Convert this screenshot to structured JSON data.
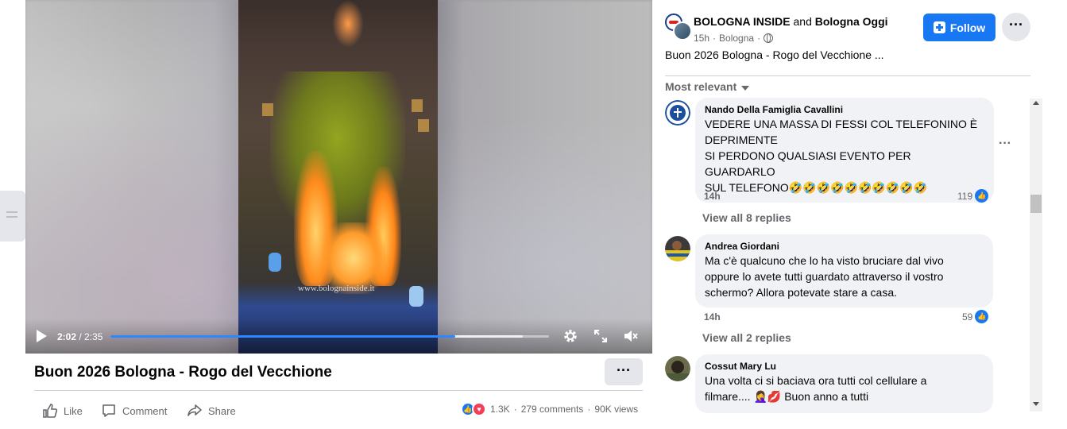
{
  "video": {
    "watermark": "www.bolognainside.it",
    "time_current": "2:02",
    "time_duration": "/ 2:35",
    "progress": 0.787,
    "buffered": 0.94
  },
  "post": {
    "title": "Buon 2026 Bologna - Rogo del Vecchione",
    "more_label": "···",
    "actions": {
      "like": "Like",
      "comment": "Comment",
      "share": "Share"
    },
    "stats": {
      "reactions": "1.3K",
      "comments": "279 comments",
      "views": "90K views",
      "sep": "·"
    }
  },
  "panel": {
    "page_name": "BOLOGNA INSIDE",
    "and_label": "and",
    "collaborator": "Bologna Oggi",
    "meta_time": "15h",
    "meta_location": "Bologna",
    "meta_dot": "·",
    "follow_label": "Follow",
    "more_label": "···",
    "caption": "Buon 2026 Bologna - Rogo del Vecchione ...",
    "sort_label": "Most relevant"
  },
  "comments": [
    {
      "name": "Nando Della Famiglia Cavallini",
      "lines": [
        "VEDERE UNA MASSA DI FESSI COL TELEFONINO È",
        "DEPRIMENTE",
        "SI PERDONO QUALSIASI EVENTO PER GUARDARLO",
        "SUL TELEFONO🤣🤣🤣🤣🤣🤣🤣🤣🤣🤣"
      ],
      "time": "14h",
      "likes": "119",
      "replies": "View all 8 replies",
      "options": "···"
    },
    {
      "name": "Andrea Giordani",
      "lines": [
        "Ma c'è qualcuno che lo ha visto bruciare dal vivo",
        "oppure lo avete tutti guardato attraverso il vostro",
        "schermo? Allora potevate stare a casa."
      ],
      "time": "14h",
      "likes": "59",
      "replies": "View all 2 replies"
    },
    {
      "name": "Cossut Mary Lu",
      "lines": [
        "Una volta ci si baciava ora tutti col cellulare a",
        "filmare.... 🤦‍♀️💋 Buon anno a tutti"
      ]
    }
  ],
  "colors": {
    "accent": "#1877f2",
    "bubble": "#f0f2f5",
    "muted": "#65676b",
    "love": "#f33e58"
  }
}
